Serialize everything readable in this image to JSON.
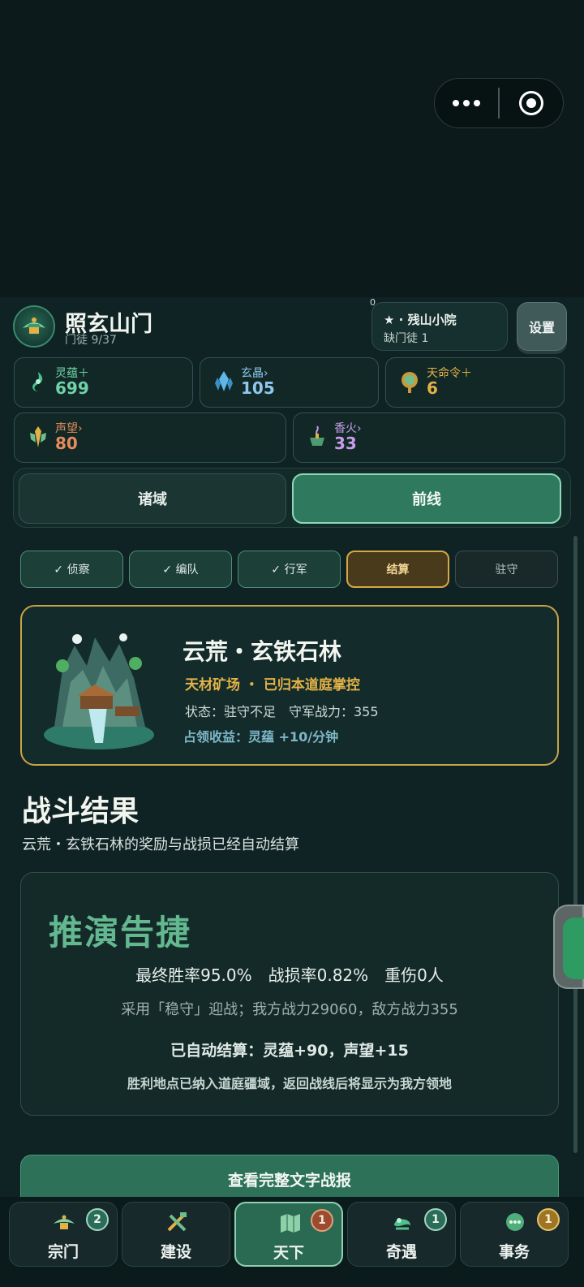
{
  "capsule": {
    "more_icon": "more-dots-icon",
    "close_icon": "target-circle-icon"
  },
  "header": {
    "sect_name": "照玄山门",
    "disciples": "门徒 9/37",
    "counter": "0",
    "courtyard_title": "★ · 残山小院",
    "courtyard_sub": "缺门徒 1",
    "settings_label": "设置"
  },
  "resources": [
    {
      "label": "灵蕴＋",
      "value": "699",
      "icon": "spirit-essence-icon",
      "color": "#6fd3a8"
    },
    {
      "label": "玄晶›",
      "value": "105",
      "icon": "crystal-icon",
      "color": "#8fc7ef"
    },
    {
      "label": "天命令＋",
      "value": "6",
      "icon": "jade-token-icon",
      "color": "#e3b247"
    },
    {
      "label": "声望›",
      "value": "80",
      "icon": "prestige-icon",
      "color": "#e58c5c"
    },
    {
      "label": "香火›",
      "value": "33",
      "icon": "incense-icon",
      "color": "#c79ce8"
    }
  ],
  "segment_tabs": [
    "诸域",
    "前线"
  ],
  "steps": [
    "✓ 侦察",
    "✓ 编队",
    "✓ 行军",
    "结算",
    "驻守"
  ],
  "location": {
    "name": "云荒・玄铁石林",
    "tag": "天材矿场 ・ 已归本道庭掌控",
    "state": "状态：驻守不足　守军战力：355",
    "income": "占领收益：灵蕴 +10/分钟"
  },
  "result": {
    "title": "战斗结果",
    "subtitle": "云荒・玄铁石林的奖励与战损已经自动结算",
    "headline": "推演告捷",
    "stats": "最终胜率95.0%　战损率0.82%　重伤0人",
    "detail": "采用「稳守」迎战；我方战力29060，敌方战力355",
    "settled": "已自动结算：灵蕴+90，声望+15",
    "note": "胜利地点已纳入道庭疆域，返回战线后将显示为我方领地"
  },
  "report_button": "查看完整文字战报",
  "nav": [
    {
      "label": "宗门",
      "badge": "2",
      "icon": "sect-icon"
    },
    {
      "label": "建设",
      "badge": "",
      "icon": "build-tools-icon"
    },
    {
      "label": "天下",
      "badge": "1",
      "icon": "world-map-icon"
    },
    {
      "label": "奇遇",
      "badge": "1",
      "icon": "encounter-icon"
    },
    {
      "label": "事务",
      "badge": "1",
      "icon": "affairs-icon"
    }
  ]
}
